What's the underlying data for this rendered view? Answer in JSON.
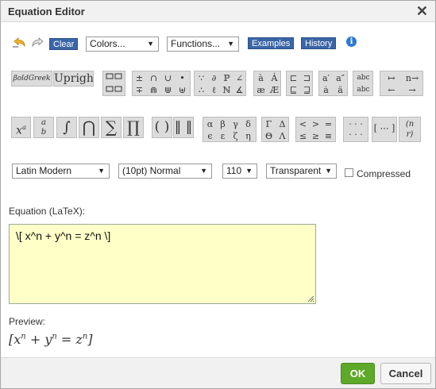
{
  "window": {
    "title": "Equation Editor"
  },
  "toolbar": {
    "undo_icon": "undo-icon",
    "redo_icon": "redo-icon",
    "clear_label": "Clear",
    "colors_label": "Colors...",
    "functions_label": "Functions...",
    "examples_label": "Examples",
    "history_label": "History",
    "info_icon": "info-icon"
  },
  "palette": {
    "font_buttons": [
      "βoldGreek",
      "Upright"
    ],
    "row2_symbols": [
      "x",
      "a/b",
      "∫",
      "⋂",
      "∑",
      "∏",
      "( )",
      "‖ ‖"
    ],
    "greek_lower": [
      "α",
      "β",
      "γ",
      "δ",
      "ϵ",
      "ε",
      "ζ",
      "η"
    ],
    "greek_upper": [
      "Γ",
      "Δ",
      "Θ",
      "Λ"
    ],
    "relations": [
      "<",
      ">",
      "=",
      "≤",
      "≥",
      "≡"
    ]
  },
  "settings": {
    "font": "Latin Modern",
    "size": "(10pt) Normal",
    "dpi": "110",
    "background": "Transparent",
    "compressed_label": "Compressed",
    "compressed_checked": false
  },
  "equation": {
    "label": "Equation (LaTeX):",
    "latex": "\\[ x^n + y^n = z^n \\]"
  },
  "preview": {
    "label": "Preview:"
  },
  "footer": {
    "ok_label": "OK",
    "cancel_label": "Cancel"
  },
  "colors": {
    "accent_blue": "#3a65a8",
    "ok_green": "#5ea82a",
    "latex_bg": "#ffffc8"
  }
}
